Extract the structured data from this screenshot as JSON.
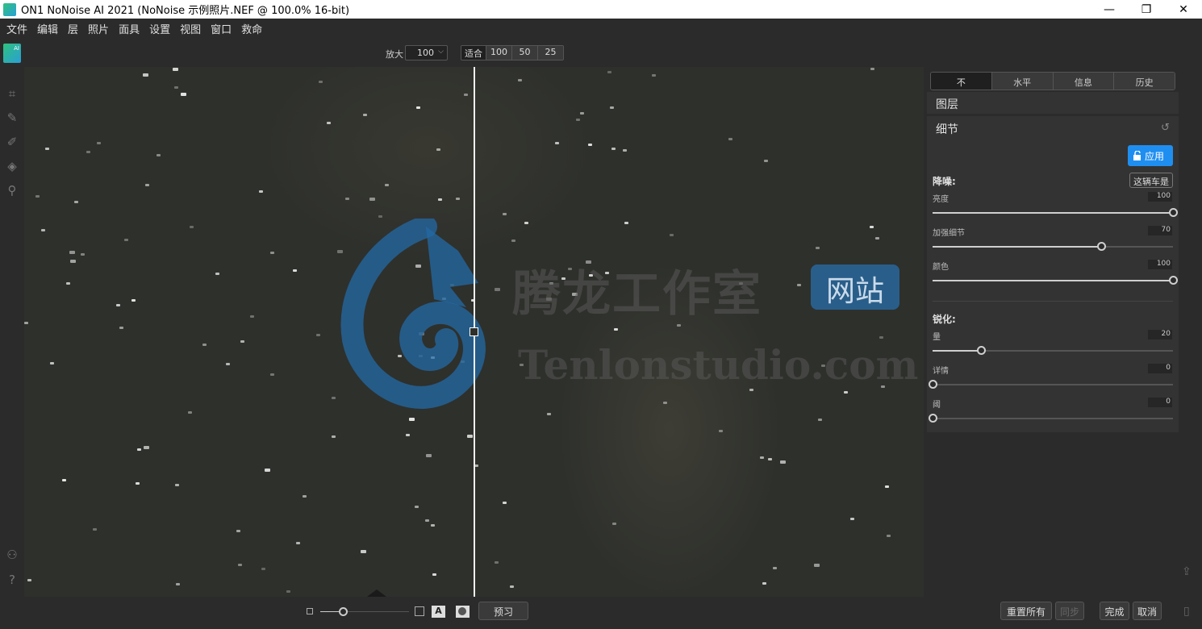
{
  "window": {
    "title": "ON1 NoNoise AI 2021 (NoNoise 示例照片.NEF @ 100.0% 16-bit)",
    "minimize": "—",
    "restore": "❐",
    "close": "✕"
  },
  "menu": [
    "文件",
    "编辑",
    "层",
    "照片",
    "面具",
    "设置",
    "视图",
    "窗口",
    "救命"
  ],
  "toolbar": {
    "logo_badge": "AI",
    "zoom_label": "放大",
    "zoom_value": "100",
    "zoom_buttons": [
      "适合",
      "100",
      "50",
      "25"
    ]
  },
  "watermark": {
    "cn": "腾龙工作室",
    "badge": "网站",
    "en": "Tenlonstudio.com"
  },
  "panel": {
    "tabs": [
      "不",
      "水平",
      "信息",
      "历史"
    ],
    "layers_title": "图层",
    "detail_title": "细节",
    "apply_label": "应用",
    "preset_label": "这辆车是",
    "noise_group": "降噪:",
    "sharpen_group": "锐化:",
    "sliders": [
      {
        "label": "亮度",
        "value": 100
      },
      {
        "label": "加强细节",
        "value": 70
      },
      {
        "label": "颜色",
        "value": 100
      },
      {
        "label": "量",
        "value": 20
      },
      {
        "label": "详情",
        "value": 0
      },
      {
        "label": "阈",
        "value": 0
      }
    ]
  },
  "bottom": {
    "preview_label": "预习",
    "reset_all_label": "重置所有",
    "sync_label": "同步",
    "done_label": "完成",
    "cancel_label": "取消",
    "a_label": "A",
    "thumb_size": 0.25
  },
  "colors": {
    "accent": "#1f8ef1",
    "background": "#2b2b2b"
  }
}
